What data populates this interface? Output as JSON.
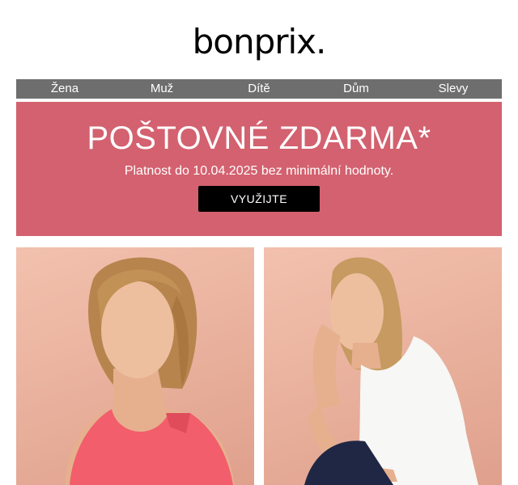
{
  "brand": {
    "logo_text": "bonprix."
  },
  "nav": {
    "items": [
      {
        "label": "Žena"
      },
      {
        "label": "Muž"
      },
      {
        "label": "Dítě"
      },
      {
        "label": "Dům"
      },
      {
        "label": "Slevy"
      }
    ]
  },
  "promo": {
    "title": "POŠTOVNÉ ZDARMA*",
    "subtitle": "Platnost do 10.04.2025 bez minimální hodnoty.",
    "button_label": "VYUŽIJTE",
    "background_color": "#d3616f",
    "button_color": "#000000"
  },
  "images": {
    "left": {
      "icon": "woman-pink-top-photo"
    },
    "right": {
      "icon": "woman-white-top-photo"
    }
  },
  "colors": {
    "nav_background": "#6e6e6e",
    "photo_background": "#eab39f"
  }
}
